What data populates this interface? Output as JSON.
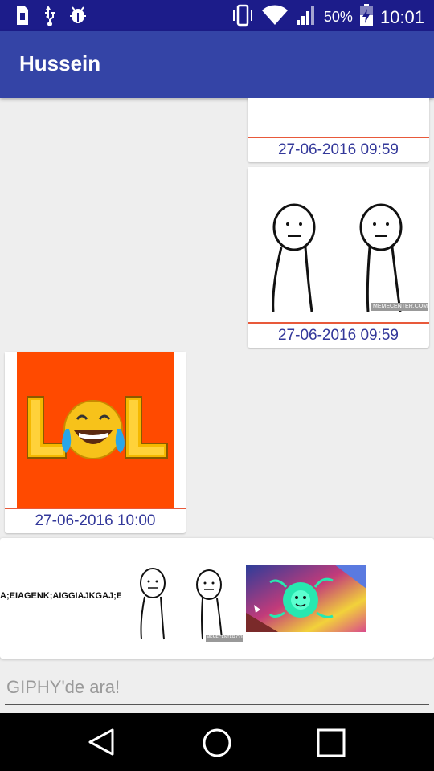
{
  "status_bar": {
    "battery_percent": "50%",
    "time": "10:01",
    "icons": [
      "sim-card-icon",
      "usb-icon",
      "android-debug-icon",
      "vibrate-icon",
      "wifi-icon",
      "signal-icon",
      "battery-charging-icon"
    ]
  },
  "app_bar": {
    "title": "Hussein"
  },
  "messages": [
    {
      "side": "right",
      "image": "white-image",
      "timestamp": "27-06-2016 09:59"
    },
    {
      "side": "right",
      "image": "two-stick-figures-meme",
      "timestamp": "27-06-2016 09:59",
      "watermark": "MEMECENTER.COM"
    },
    {
      "side": "left",
      "image": "lol-crying-laughing-emoji",
      "timestamp": "27-06-2016 10:00"
    }
  ],
  "gif_results": {
    "items": [
      {
        "name": "text-gif",
        "text": "A;EIAGENK;AIGGIAJKGAJ;EOA"
      },
      {
        "name": "stick-figures-gif",
        "watermark": "MEMECENTER.COM"
      },
      {
        "name": "colorful-creature-gif"
      }
    ]
  },
  "search": {
    "placeholder": "GIPHY'de ara!"
  },
  "nav_bar": {
    "buttons": [
      "back-icon",
      "home-icon",
      "recents-icon"
    ]
  },
  "colors": {
    "status_bar": "#1c1c8a",
    "app_bar": "#3444a6",
    "timestamp_text": "#33389a",
    "divider": "#e8593a",
    "lol_background": "#ff4a00"
  }
}
